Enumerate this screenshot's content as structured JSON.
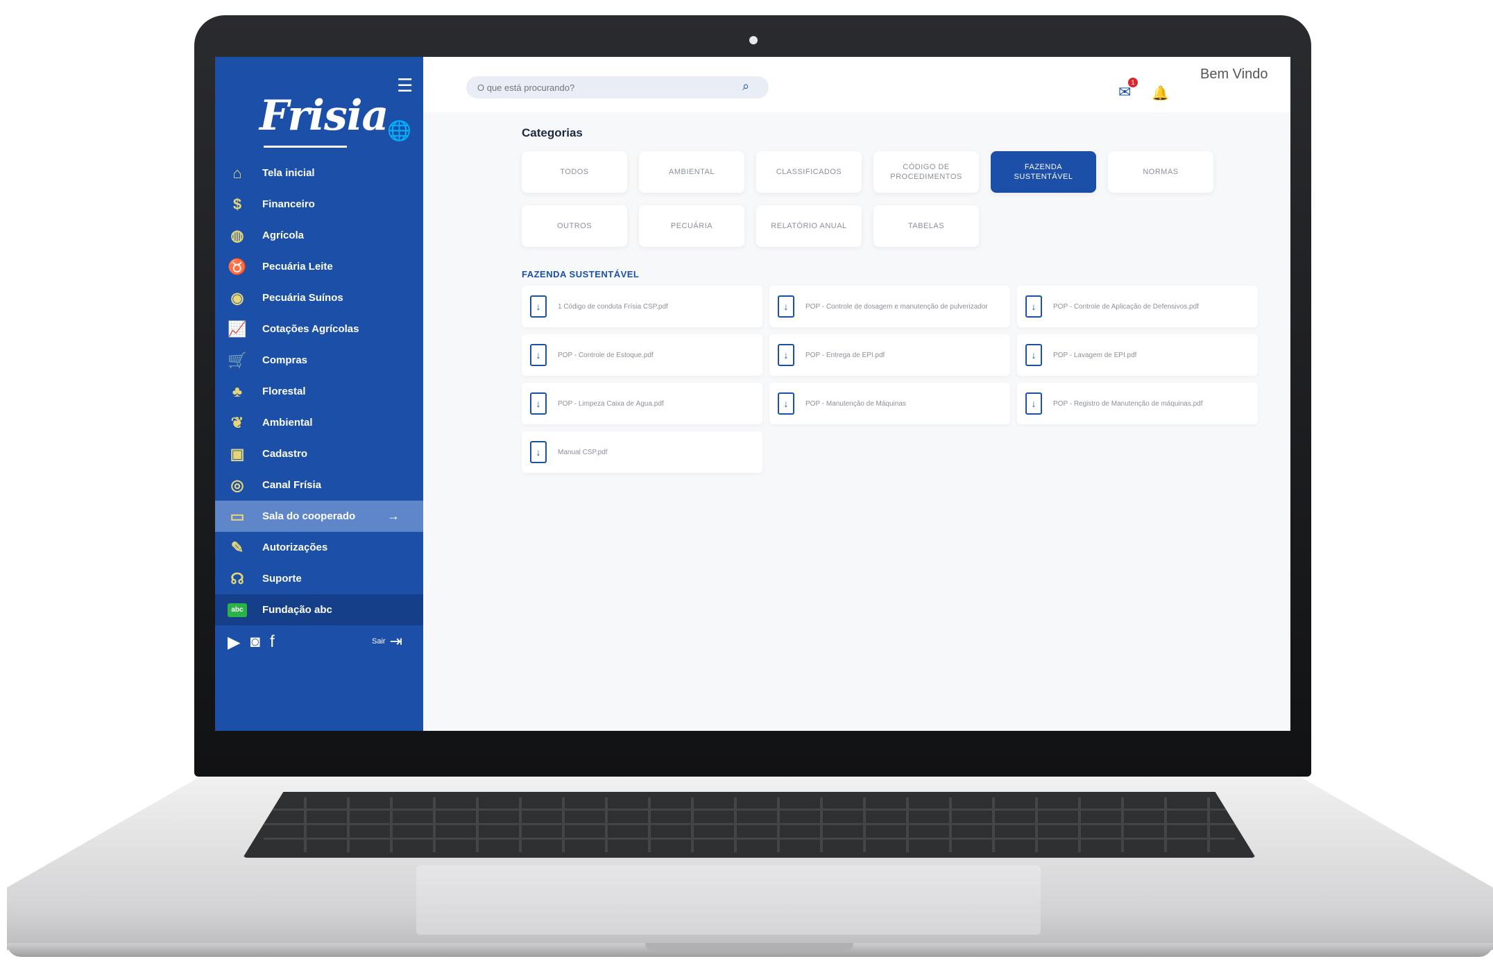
{
  "sidebar": {
    "brand": "Frisia",
    "items": [
      {
        "label": "Tela inicial",
        "icon": "home-icon"
      },
      {
        "label": "Financeiro",
        "icon": "dollar-icon"
      },
      {
        "label": "Agrícola",
        "icon": "globe-icon"
      },
      {
        "label": "Pecuária Leite",
        "icon": "cow-icon"
      },
      {
        "label": "Pecuária Suínos",
        "icon": "pig-icon"
      },
      {
        "label": "Cotações Agrícolas",
        "icon": "chart-icon"
      },
      {
        "label": "Compras",
        "icon": "cart-icon"
      },
      {
        "label": "Florestal",
        "icon": "tree-icon"
      },
      {
        "label": "Ambiental",
        "icon": "leaf-icon"
      },
      {
        "label": "Cadastro",
        "icon": "id-card-icon"
      },
      {
        "label": "Canal Frísia",
        "icon": "broadcast-icon"
      },
      {
        "label": "Sala do cooperado",
        "icon": "folder-icon",
        "active": true
      },
      {
        "label": "Autorizações",
        "icon": "pen-icon"
      },
      {
        "label": "Suporte",
        "icon": "support-icon"
      },
      {
        "label": "Fundação abc",
        "icon": "fundacao-logo"
      }
    ],
    "fund_logo_text": "abc",
    "exit_label": "Sair"
  },
  "topbar": {
    "search_placeholder": "O que está procurando?",
    "chat_badge": "1",
    "welcome": "Bem Vindo"
  },
  "main": {
    "categories_title": "Categorias",
    "categories": [
      {
        "label": "TODOS"
      },
      {
        "label": "AMBIENTAL"
      },
      {
        "label": "CLASSIFICADOS"
      },
      {
        "label": "CÓDIGO DE PROCEDIMENTOS"
      },
      {
        "label": "FAZENDA SUSTENTÁVEL",
        "active": true
      },
      {
        "label": "NORMAS"
      },
      {
        "label": "OUTROS"
      },
      {
        "label": "PECUÁRIA"
      },
      {
        "label": "RELATÓRIO ANUAL"
      },
      {
        "label": "TABELAS"
      }
    ],
    "section_title": "FAZENDA SUSTENTÁVEL",
    "files": [
      "1 Código de conduta Frísia CSP.pdf",
      "POP - Controle de dosagem e manutenção de pulverizador",
      "POP - Controle de Aplicação de Defensivos.pdf",
      "POP - Controle de Estoque.pdf",
      "POP - Entrega de EPI.pdf",
      "POP - Lavagem de EPI.pdf",
      "POP - Limpeza Caixa de Água.pdf",
      "POP - Manutenção de Máquinas",
      "POP - Registro de Manutenção de máquinas.pdf",
      "Manual CSP.pdf"
    ]
  },
  "colors": {
    "primary": "#1b4fa8",
    "active_nav": "#5f86c9",
    "icon_accent": "#e6d67a",
    "badge": "#d8282f"
  }
}
